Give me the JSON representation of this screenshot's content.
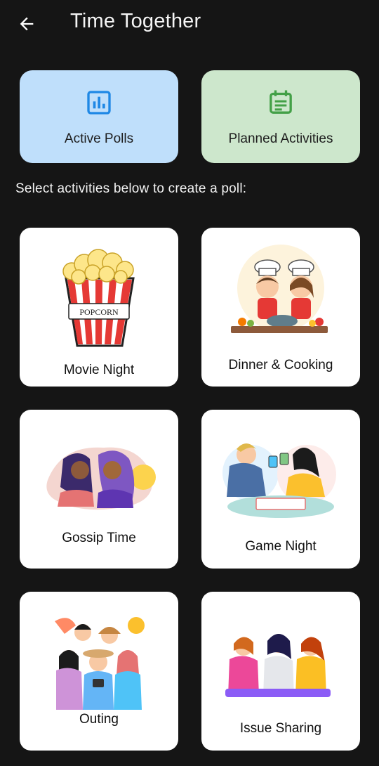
{
  "header": {
    "title": "Time Together",
    "back_icon": "arrow-left-icon"
  },
  "quick_actions": [
    {
      "label": "Active Polls",
      "icon": "bar-chart-icon",
      "bg": "#bfdffb",
      "icon_color": "#1e88e5"
    },
    {
      "label": "Planned Activities",
      "icon": "event-note-icon",
      "bg": "#cde7cc",
      "icon_color": "#43a047"
    }
  ],
  "prompt": "Select activities below to create a poll:",
  "activities": [
    {
      "label": "Movie Night",
      "image": "popcorn-illustration",
      "image_text": "POPCORN"
    },
    {
      "label": "Dinner & Cooking",
      "image": "kids-cooking-illustration"
    },
    {
      "label": "Gossip Time",
      "image": "women-whispering-illustration"
    },
    {
      "label": "Game Night",
      "image": "board-game-illustration"
    },
    {
      "label": "Outing",
      "image": "group-of-friends-illustration"
    },
    {
      "label": "Issue Sharing",
      "image": "friends-comforting-illustration"
    }
  ],
  "colors": {
    "background": "#151515",
    "card": "#ffffff"
  }
}
